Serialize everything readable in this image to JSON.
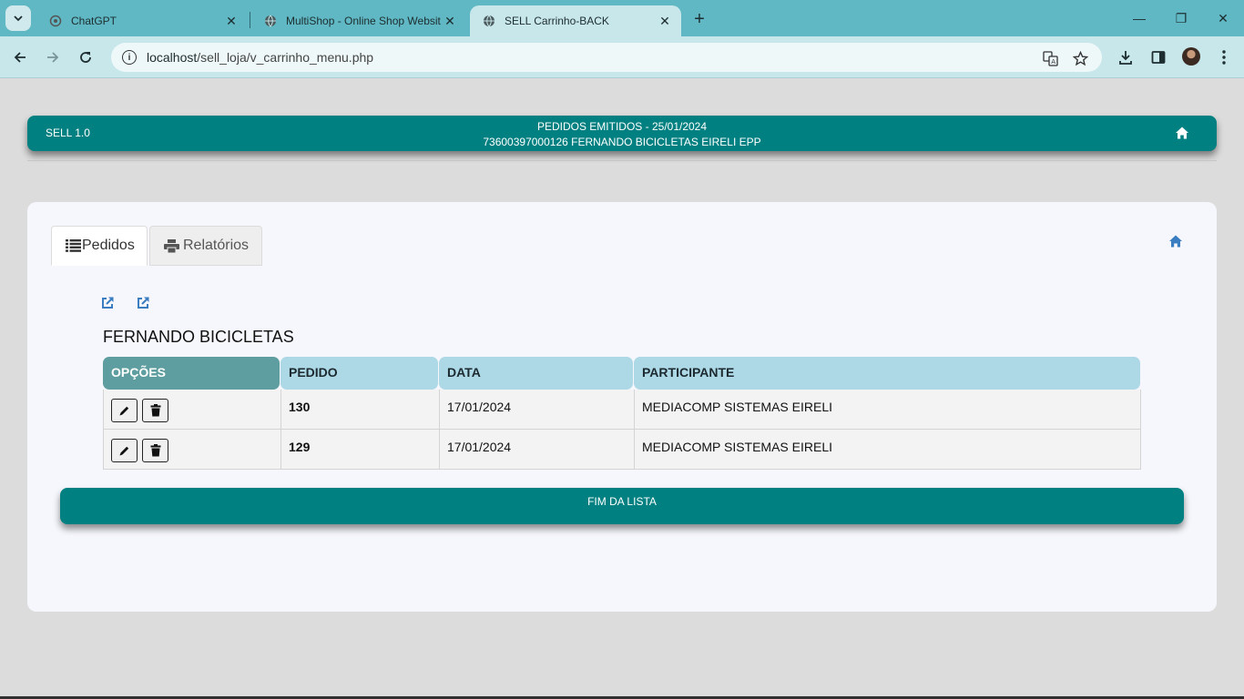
{
  "browser": {
    "tabs": [
      {
        "title": "ChatGPT",
        "close": "✕",
        "icon": "openai-icon"
      },
      {
        "title": "MultiShop - Online Shop Website",
        "close": "✕",
        "icon": "globe-icon"
      },
      {
        "title": "SELL Carrinho-BACK",
        "close": "✕",
        "icon": "globe-icon"
      }
    ],
    "new_tab": "+",
    "window": {
      "minimize": "—",
      "restore": "❐",
      "close": "✕"
    },
    "url_host": "localhost",
    "url_path": "/sell_loja/v_carrinho_menu.php"
  },
  "header": {
    "brand": "SELL 1.0",
    "line1": "PEDIDOS EMITIDOS - 25/01/2024",
    "line2": "73600397000126 FERNANDO BICICLETAS EIRELI EPP"
  },
  "tabs": {
    "pedidos": "Pedidos",
    "relatorios": "Relatórios"
  },
  "section_title": "FERNANDO BICICLETAS",
  "table": {
    "headers": [
      "OPÇÕES",
      "PEDIDO",
      "DATA",
      "PARTICIPANTE"
    ],
    "rows": [
      {
        "pedido": "130",
        "data": "17/01/2024",
        "participante": "MEDIACOMP SISTEMAS EIRELI"
      },
      {
        "pedido": "129",
        "data": "17/01/2024",
        "participante": "MEDIACOMP SISTEMAS EIRELI"
      }
    ]
  },
  "footer_bar": "FIM DA LISTA",
  "colors": {
    "brand": "#008080",
    "header_opt": "#5f9ea0",
    "header_col": "#add8e6",
    "icon_blue": "#3a7dc0"
  }
}
